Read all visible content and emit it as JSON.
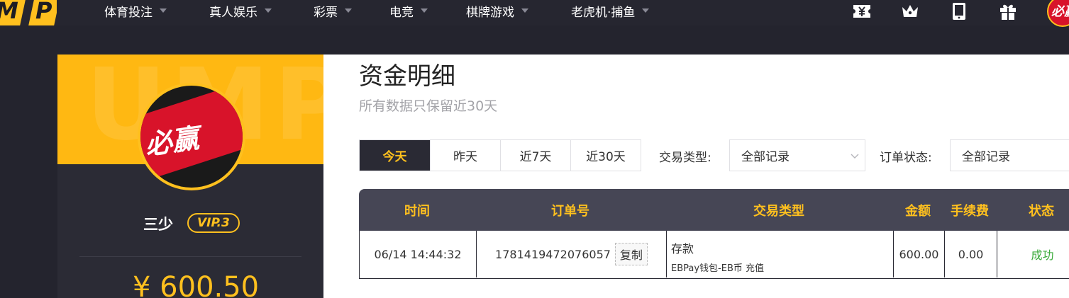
{
  "brand": {
    "logo_text": "MP",
    "accent": "#ffc01e",
    "dark": "#24242e"
  },
  "nav": [
    {
      "label": "体育投注"
    },
    {
      "label": "真人娱乐"
    },
    {
      "label": "彩票"
    },
    {
      "label": "电竞"
    },
    {
      "label": "棋牌游戏"
    },
    {
      "label": "老虎机·捕鱼"
    }
  ],
  "toolbar_icons": [
    "yen-ticket-icon",
    "crown-icon",
    "tablet-icon",
    "gift-icon"
  ],
  "profile": {
    "avatar_text": "必赢",
    "banner_watermark": "UMP",
    "username": "三少",
    "vip": "VIP.3",
    "balance": "¥ 600.50"
  },
  "page": {
    "title": "资金明细",
    "subtitle": "所有数据只保留近30天"
  },
  "filters": {
    "date_ranges": [
      "今天",
      "昨天",
      "近7天",
      "近30天"
    ],
    "active_range": "今天",
    "transaction_type_label": "交易类型:",
    "transaction_type_value": "全部记录",
    "order_status_label": "订单状态:",
    "order_status_value": "全部记录"
  },
  "table": {
    "headers": [
      "时间",
      "订单号",
      "交易类型",
      "金额",
      "手续费",
      "状态"
    ],
    "rows": [
      {
        "time": "06/14 14:44:32",
        "order_no": "1781419472076057",
        "copy_label": "复制",
        "type": "存款",
        "type_detail": "EBPay钱包-EB币 充值",
        "amount": "600.00",
        "fee": "0.00",
        "status": "成功"
      }
    ]
  }
}
